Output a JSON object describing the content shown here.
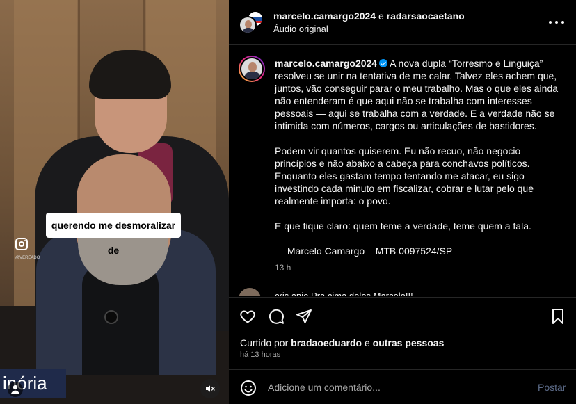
{
  "video": {
    "caption": "querendo me desmoralizar de",
    "watermark": "@VEREADO",
    "lower_third": "inória"
  },
  "header": {
    "user1": "marcelo.camargo2024",
    "joiner": "e",
    "user2": "radarsaocaetano",
    "audio": "Áudio original"
  },
  "post": {
    "username": "marcelo.camargo2024",
    "paragraphs": [
      "A nova dupla “Torresmo e Linguiça” resolveu se unir na tentativa de me calar. Talvez eles achem que, juntos, vão conseguir parar o meu trabalho. Mas o que eles ainda não entenderam é que aqui não se trabalha com interesses pessoais — aqui se trabalha com a verdade. E a verdade não se intimida com números, cargos ou articulações de bastidores.",
      "Podem vir quantos quiserem. Eu não recuo, não negocio princípios e não abaixo a cabeça para conchavos políticos. Enquanto eles gastam tempo tentando me atacar, eu sigo investindo cada minuto em fiscalizar, cobrar e lutar pelo que realmente importa: o povo.",
      "E que fique claro: quem teme a verdade, teme quem a fala.",
      "— Marcelo Camargo – MTB 0097524/SP"
    ],
    "time": "13 h",
    "next_comment": "cris.anie Pra cima deles Marcelo!!!"
  },
  "actions": {
    "liked_prefix": "Curtido por",
    "liked_user": "bradaoeduardo",
    "liked_joiner": "e",
    "liked_others": "outras pessoas",
    "time_ago": "há 13 horas"
  },
  "comment_box": {
    "placeholder": "Adicione um comentário...",
    "post_label": "Postar"
  },
  "icons": {
    "like": "heart-icon",
    "comment": "comment-bubble-icon",
    "share": "paper-plane-icon",
    "save": "bookmark-icon",
    "emoji": "smiley-icon",
    "mute": "speaker-muted-icon",
    "more": "more-dots-icon"
  },
  "colors": {
    "background": "#000000",
    "verified": "#0095f6",
    "muted_text": "#a8a8a8",
    "post_button": "#5d6c8a"
  }
}
